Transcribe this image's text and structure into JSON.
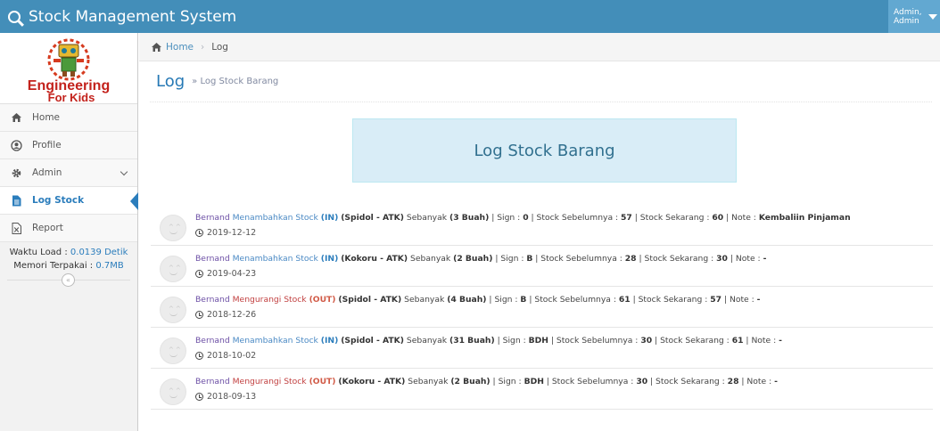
{
  "app": {
    "title": "Stock Management System"
  },
  "user": {
    "line1": "Admin,",
    "line2": "Admin"
  },
  "logo": {
    "line1": "Engineering",
    "line2": "For Kids"
  },
  "sidebar": {
    "items": [
      {
        "label": "Home",
        "icon": "home-icon"
      },
      {
        "label": "Profile",
        "icon": "user-circle-icon"
      },
      {
        "label": "Admin",
        "icon": "cog-icon"
      },
      {
        "label": "Log Stock",
        "icon": "file-icon"
      },
      {
        "label": "Report",
        "icon": "excel-file-icon"
      }
    ],
    "load_label": "Waktu Load :",
    "load_value": "0.0139 Detik",
    "memory_label": "Memori Terpakai :",
    "memory_value": "0.7MB"
  },
  "breadcrumb": {
    "home": "Home",
    "current": "Log"
  },
  "page": {
    "title": "Log",
    "subtitle": "» Log Stock Barang",
    "box_title": "Log Stock Barang"
  },
  "logs": [
    {
      "user": "Bernand",
      "action": "Menambahkan Stock",
      "type": "(IN)",
      "item": "(Spidol - ATK)",
      "qty_label": "Sebanyak",
      "qty": "(3 Buah)",
      "sign": "0",
      "before": "57",
      "after": "60",
      "note": "Kembaliin Pinjaman",
      "date": "2019-12-12"
    },
    {
      "user": "Bernand",
      "action": "Menambahkan Stock",
      "type": "(IN)",
      "item": "(Kokoru - ATK)",
      "qty_label": "Sebanyak",
      "qty": "(2 Buah)",
      "sign": "B",
      "before": "28",
      "after": "30",
      "note": "-",
      "date": "2019-04-23"
    },
    {
      "user": "Bernand",
      "action": "Mengurangi Stock",
      "type": "(OUT)",
      "item": "(Spidol - ATK)",
      "qty_label": "Sebanyak",
      "qty": "(4 Buah)",
      "sign": "B",
      "before": "61",
      "after": "57",
      "note": "-",
      "date": "2018-12-26"
    },
    {
      "user": "Bernand",
      "action": "Menambahkan Stock",
      "type": "(IN)",
      "item": "(Spidol - ATK)",
      "qty_label": "Sebanyak",
      "qty": "(31 Buah)",
      "sign": "BDH",
      "before": "30",
      "after": "61",
      "note": "-",
      "date": "2018-10-02"
    },
    {
      "user": "Bernand",
      "action": "Mengurangi Stock",
      "type": "(OUT)",
      "item": "(Kokoru - ATK)",
      "qty_label": "Sebanyak",
      "qty": "(2 Buah)",
      "sign": "BDH",
      "before": "30",
      "after": "28",
      "note": "-",
      "date": "2018-09-13"
    }
  ],
  "log_labels": {
    "sign": "Sign :",
    "before": "Stock Sebelumnya :",
    "after": "Stock Sekarang :",
    "note": "Note :"
  },
  "colors": {
    "navbar": "#438eb9",
    "accent": "#2b7dbc",
    "in": "#2b7dbc",
    "out": "#d15b47",
    "box_bg": "#d9edf7"
  }
}
